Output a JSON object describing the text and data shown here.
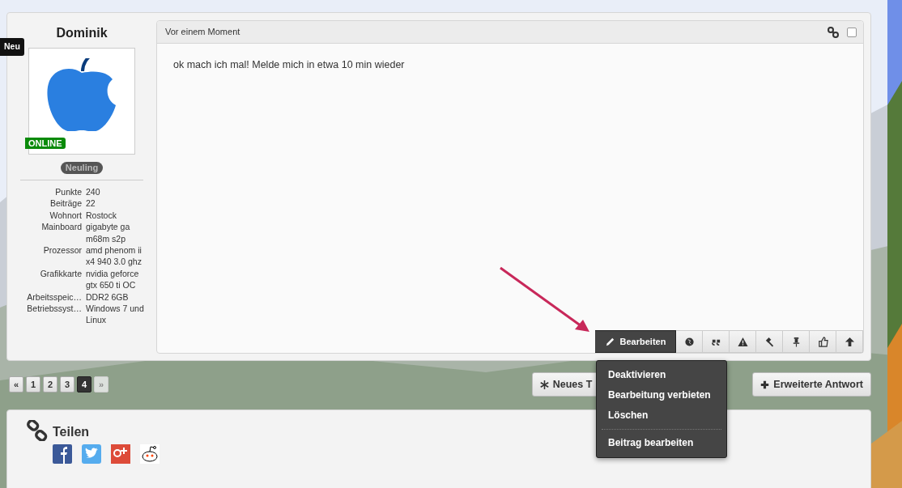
{
  "user": {
    "name": "Dominik",
    "new_badge": "Neu",
    "status": "ONLINE",
    "rank": "Neuling",
    "fields": [
      {
        "label": "Punkte",
        "value": "240"
      },
      {
        "label": "Beiträge",
        "value": "22"
      },
      {
        "label": "Wohnort",
        "value": "Rostock"
      },
      {
        "label": "Mainboard",
        "value": "gigabyte ga m68m s2p"
      },
      {
        "label": "Prozessor",
        "value": "amd phenom ii x4 940 3.0 ghz"
      },
      {
        "label": "Grafikkarte",
        "value": "nvidia geforce gtx 650 ti OC"
      },
      {
        "label": "Arbeitsspeic…",
        "value": "DDR2 6GB"
      },
      {
        "label": "Betriebssyst…",
        "value": "Windows 7 und Linux"
      }
    ]
  },
  "post": {
    "time": "Vor einem Moment",
    "checked": false,
    "text": "ok mach ich mal! Melde mich in etwa 10 min wieder",
    "toolbar": [
      {
        "kind": "edit",
        "label": "Bearbeiten",
        "selected": true
      },
      {
        "kind": "globe",
        "selected": false
      },
      {
        "kind": "quote",
        "selected": false
      },
      {
        "kind": "warning",
        "selected": false
      },
      {
        "kind": "hammer",
        "selected": false
      },
      {
        "kind": "pin",
        "selected": false
      },
      {
        "kind": "thumb",
        "selected": false
      },
      {
        "kind": "up",
        "selected": false
      }
    ],
    "menu": [
      {
        "label": "Deaktivieren",
        "divider_before": false
      },
      {
        "label": "Bearbeitung verbieten",
        "divider_before": false
      },
      {
        "label": "Löschen",
        "divider_before": false
      },
      {
        "label": "Beitrag bearbeiten",
        "divider_before": true
      }
    ]
  },
  "pagination": [
    {
      "label": "«",
      "selected": false,
      "disabled": false
    },
    {
      "label": "1",
      "selected": false,
      "disabled": false
    },
    {
      "label": "2",
      "selected": false,
      "disabled": false
    },
    {
      "label": "3",
      "selected": false,
      "disabled": false
    },
    {
      "label": "4",
      "selected": true,
      "disabled": false
    },
    {
      "label": "»",
      "selected": false,
      "disabled": true
    }
  ],
  "actions": [
    {
      "kind": "asterisk",
      "label": "Neues T"
    },
    {
      "kind": "plus",
      "label": "Erweiterte Antwort"
    }
  ],
  "share": {
    "title": "Teilen",
    "services": [
      {
        "kind": "facebook"
      },
      {
        "kind": "twitter"
      },
      {
        "kind": "googleplus"
      },
      {
        "kind": "reddit"
      }
    ]
  }
}
